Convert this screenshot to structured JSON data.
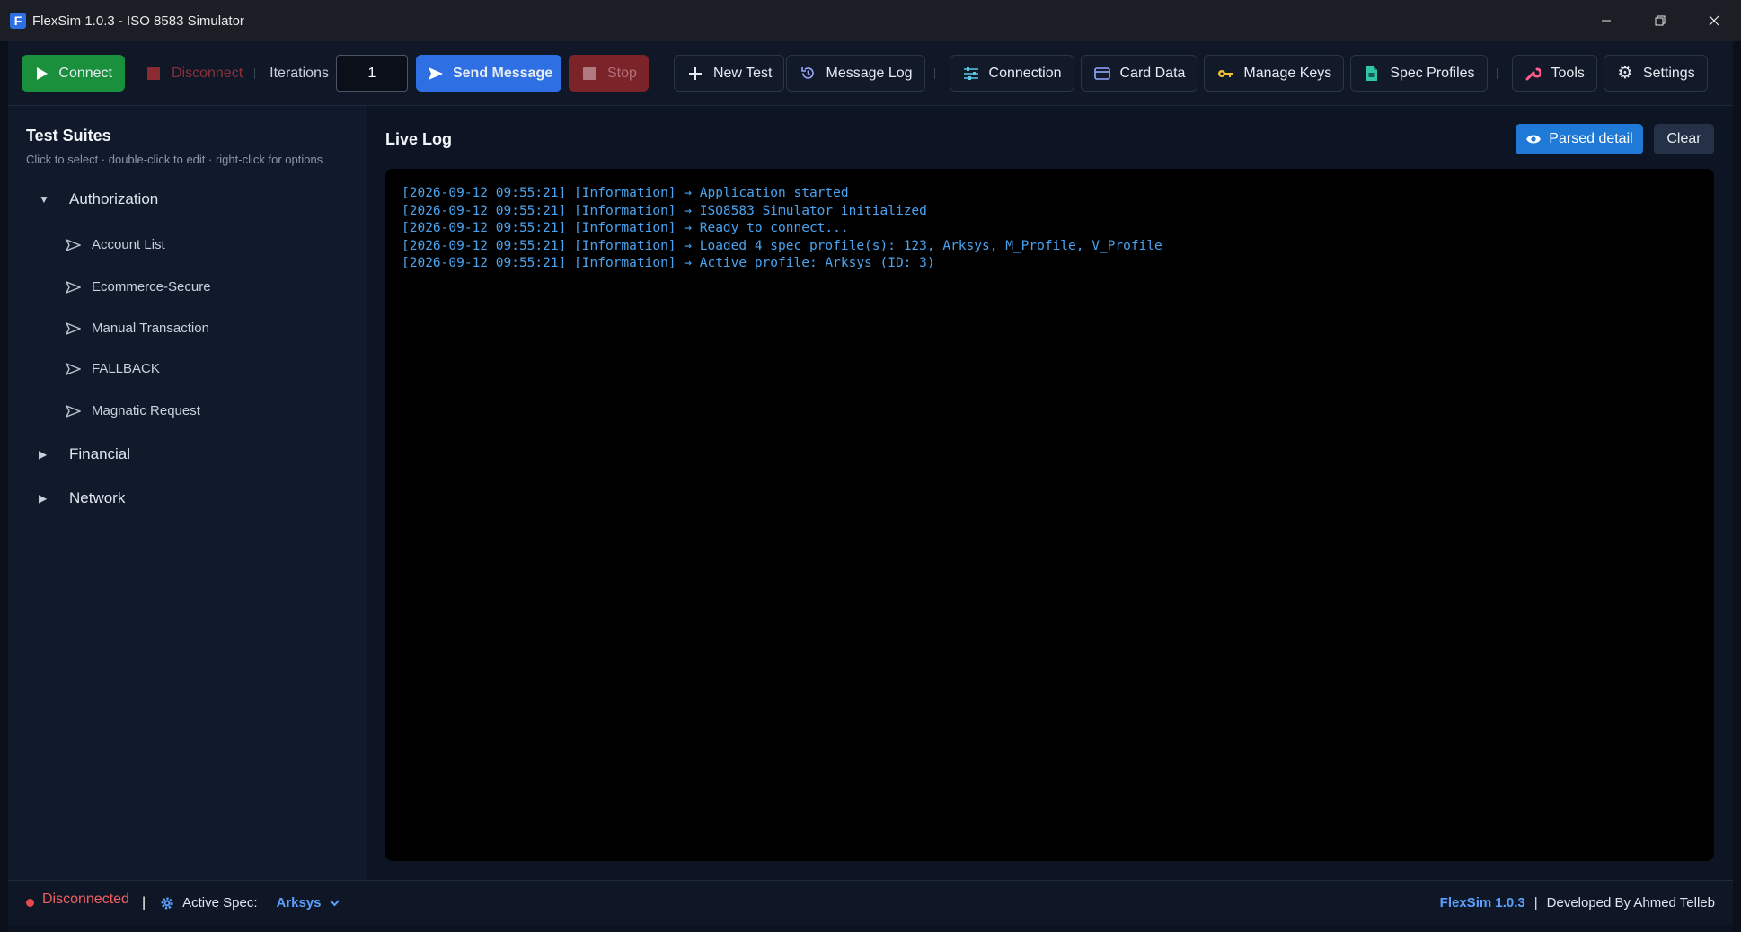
{
  "window": {
    "app_icon_letter": "F",
    "title": "FlexSim 1.0.3 - ISO 8583 Simulator"
  },
  "toolbar": {
    "connect_label": "Connect",
    "disconnect_label": "Disconnect",
    "iterations_label": "Iterations",
    "iterations_value": "1",
    "send_label": "Send Message",
    "stop_label": "Stop",
    "new_test_label": "New Test",
    "message_log_label": "Message Log",
    "connection_label": "Connection",
    "card_data_label": "Card Data",
    "manage_keys_label": "Manage Keys",
    "spec_profiles_label": "Spec Profiles",
    "tools_label": "Tools",
    "settings_label": "Settings"
  },
  "sidebar": {
    "title": "Test Suites",
    "subtitle": "Click to select · double-click to edit · right-click for options",
    "categories": [
      {
        "label": "Authorization",
        "expanded": true,
        "items": [
          "Account List",
          "Ecommerce-Secure",
          "Manual Transaction",
          "FALLBACK",
          "Magnatic Request"
        ]
      },
      {
        "label": "Financial",
        "expanded": false
      },
      {
        "label": "Network",
        "expanded": false
      }
    ]
  },
  "main": {
    "title": "Live Log",
    "parsed_detail_label": "Parsed detail",
    "clear_label": "Clear",
    "log_lines": [
      "[2026-09-12 09:55:21] [Information] → Application started",
      "[2026-09-12 09:55:21] [Information] → ISO8583 Simulator initialized",
      "[2026-09-12 09:55:21] [Information] → Ready to connect...",
      "[2026-09-12 09:55:21] [Information] → Loaded 4 spec profile(s): 123, Arksys, M_Profile, V_Profile",
      "[2026-09-12 09:55:21] [Information] → Active profile: Arksys (ID: 3)"
    ]
  },
  "status": {
    "connection_state": "Disconnected",
    "separator": "|",
    "active_spec_label": "Active Spec:",
    "active_spec_value": "Arksys",
    "brand": "FlexSim 1.0.3",
    "developer": "Developed By Ahmed Telleb"
  },
  "colors": {
    "accent_blue": "#2f6fe4",
    "connect_green": "#1a8f3c",
    "stop_red": "#7a2328",
    "log_blue": "#4aa3ef",
    "status_red": "#e34b4b"
  }
}
